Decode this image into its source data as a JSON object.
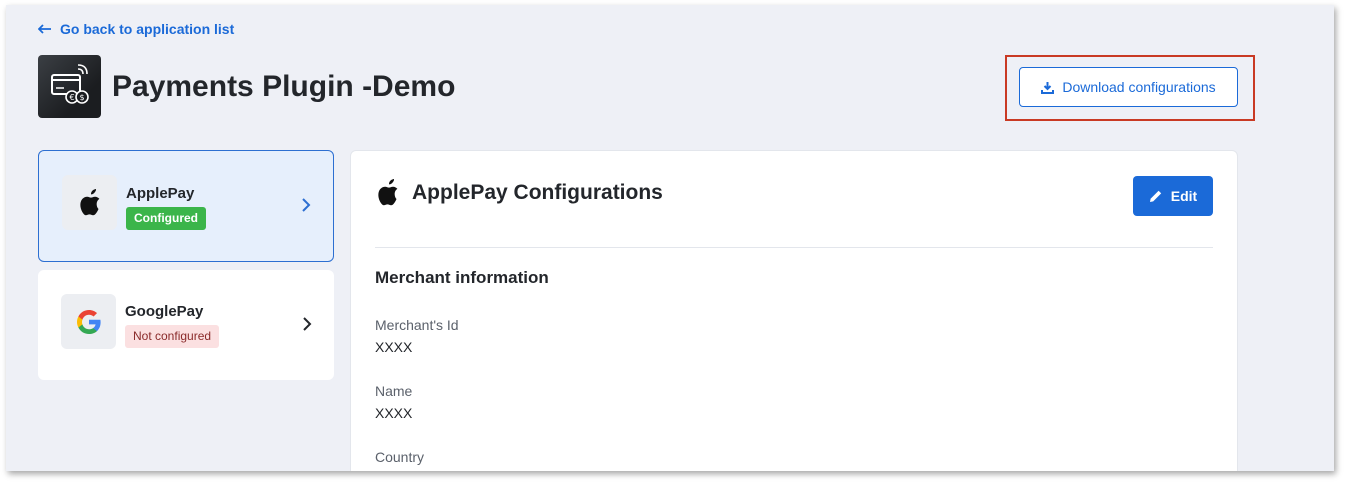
{
  "nav": {
    "back_label": "Go back to application list"
  },
  "app": {
    "title": "Payments Plugin -Demo"
  },
  "actions": {
    "download_label": "Download configurations"
  },
  "providers": [
    {
      "name": "ApplePay",
      "status": "Configured",
      "icon": "apple-icon"
    },
    {
      "name": "GooglePay",
      "status": "Not configured",
      "icon": "google-icon"
    }
  ],
  "panel": {
    "title": "ApplePay Configurations",
    "edit_label": "Edit",
    "section_title": "Merchant information",
    "fields": [
      {
        "label": "Merchant's Id",
        "value": "XXXX"
      },
      {
        "label": "Name",
        "value": "XXXX"
      },
      {
        "label": "Country",
        "value": ""
      }
    ]
  },
  "colors": {
    "primary": "#1b6ad8",
    "configured": "#3bb54a",
    "not_configured_bg": "#fbe0e1",
    "highlight": "#c93a24",
    "background": "#eef0f6"
  }
}
